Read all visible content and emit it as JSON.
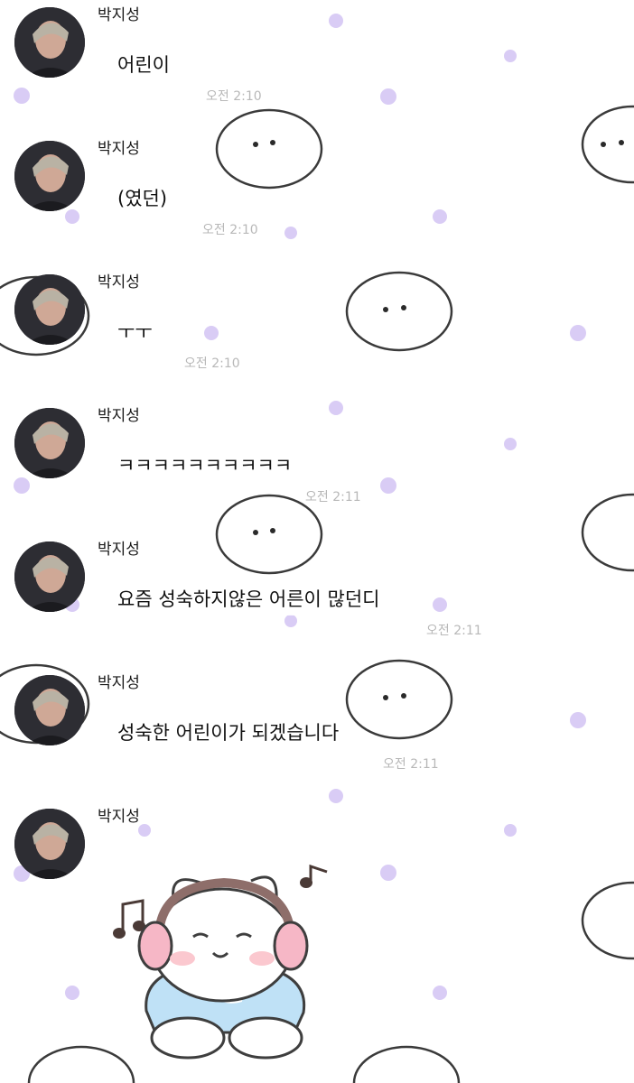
{
  "chat": {
    "messages": [
      {
        "sender": "박지성",
        "text": "어린이",
        "time": "오전 2:10"
      },
      {
        "sender": "박지성",
        "text": "(였던)",
        "time": "오전 2:10"
      },
      {
        "sender": "박지성",
        "text": "ㅜㅜ",
        "time": "오전 2:10"
      },
      {
        "sender": "박지성",
        "text": "ㅋㅋㅋㅋㅋㅋㅋㅋㅋㅋ",
        "time": "오전 2:11"
      },
      {
        "sender": "박지성",
        "text": "요즘 성숙하지않은 어른이 많던디",
        "time": "오전 2:11"
      },
      {
        "sender": "박지성",
        "text": "성숙한 어린이가 되겠습니다",
        "time": "오전 2:11"
      }
    ],
    "last": {
      "sender": "박지성",
      "sticker": "sleepy-bunny-headphones-sticker"
    }
  },
  "colors": {
    "dots": "#d6c8f4",
    "time": "#b8b8b8",
    "background": "#ffffff"
  },
  "icons": {
    "avatar": "profile-avatar",
    "background": "chick-character-pattern"
  }
}
